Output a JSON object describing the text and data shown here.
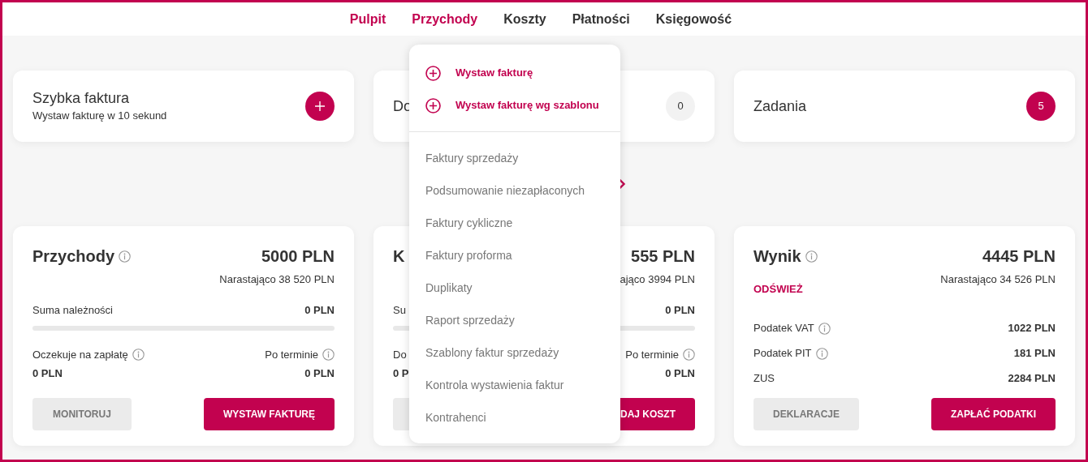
{
  "nav": [
    {
      "label": "Pulpit",
      "selected": true
    },
    {
      "label": "Przychody",
      "selected": true
    },
    {
      "label": "Koszty",
      "selected": false
    },
    {
      "label": "Płatności",
      "selected": false
    },
    {
      "label": "Księgowość",
      "selected": false
    }
  ],
  "quick_cards": [
    {
      "kind": "action",
      "title": "Szybka faktura",
      "subtitle": "Wystaw fakturę w 10 sekund"
    },
    {
      "kind": "count",
      "title": "Do",
      "count": "0",
      "highlighted": false
    },
    {
      "kind": "count",
      "title": "Zadania",
      "count": "5",
      "highlighted": true
    }
  ],
  "summary_cards": [
    {
      "kind": "balance",
      "title": "Przychody",
      "title_info": true,
      "amount": "5000 PLN",
      "cumulative": "Narastająco 38 520 PLN",
      "total_label": "Suma należności",
      "total_value": "0 PLN",
      "level": 0,
      "left_label": "Oczekuje na zapłatę",
      "left_info": true,
      "left_value": "0 PLN",
      "right_label": "Po terminie",
      "right_info": true,
      "right_value": "0 PLN",
      "buttons": [
        {
          "kind": "secondary",
          "label": "MONITORUJ"
        },
        {
          "kind": "primary",
          "label": "WYSTAW FAKTURĘ"
        }
      ]
    },
    {
      "kind": "balance",
      "title": "K",
      "title_info": false,
      "amount": "555 PLN",
      "cumulative": "ająco 3994 PLN",
      "total_label": "Su",
      "total_value": "0 PLN",
      "level": 0,
      "left_label": "Do",
      "left_info": false,
      "left_value": "0 P",
      "right_label": "Po terminie",
      "right_info": true,
      "right_value": "0 PLN",
      "buttons": [
        {
          "kind": "secondary"
        },
        {
          "kind": "primary",
          "label": "DAJ KOSZT"
        }
      ]
    },
    {
      "kind": "result",
      "title": "Wynik",
      "title_info": true,
      "amount": "4445 PLN",
      "cumulative": "Narastająco 34 526 PLN",
      "link": "ODŚWIEŻ",
      "rows": [
        {
          "label": "Podatek VAT",
          "info": true,
          "value": "1022 PLN"
        },
        {
          "label": "Podatek PIT",
          "info": true,
          "value": "181 PLN"
        },
        {
          "label": "ZUS",
          "info": false,
          "value": "2284 PLN"
        }
      ],
      "buttons": [
        {
          "kind": "secondary",
          "label": "DEKLARACJE"
        },
        {
          "kind": "primary",
          "label": "ZAPŁAĆ PODATKI"
        }
      ]
    }
  ],
  "menu": {
    "items": [
      {
        "kind": "action",
        "label": "Wystaw fakturę"
      },
      {
        "kind": "action",
        "label": "Wystaw fakturę wg szablonu"
      },
      {
        "kind": "link",
        "label": "Faktury sprzedaży"
      },
      {
        "kind": "link",
        "label": "Podsumowanie niezapłaconych"
      },
      {
        "kind": "link",
        "label": "Faktury cykliczne"
      },
      {
        "kind": "link",
        "label": "Faktury proforma"
      },
      {
        "kind": "link",
        "label": "Duplikaty"
      },
      {
        "kind": "link",
        "label": "Raport sprzedaży"
      },
      {
        "kind": "link",
        "label": "Szablony faktur sprzedaży"
      },
      {
        "kind": "link",
        "label": "Kontrola wystawienia faktur"
      },
      {
        "kind": "link",
        "label": "Kontrahenci"
      }
    ]
  }
}
